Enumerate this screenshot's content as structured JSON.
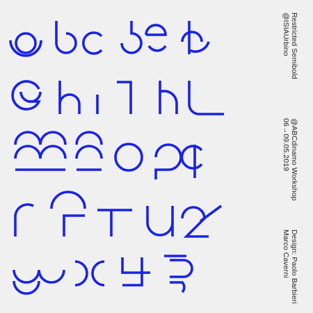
{
  "poster": {
    "accent_color": "#1a22e6",
    "background_color": "#f0f0f0",
    "glyph_rows": [
      [
        "a",
        "b",
        "c",
        "d",
        "e",
        "f"
      ],
      [
        "g",
        "h",
        "i",
        "j",
        "k",
        "l"
      ],
      [
        "m",
        "n",
        "o",
        "p",
        "q"
      ],
      [
        "r",
        "s",
        "t",
        "u",
        "v"
      ],
      [
        "w",
        "x",
        "y",
        "z"
      ]
    ],
    "credits": {
      "typeface": [
        "Restricted Semibold",
        "@ISIAUrbino"
      ],
      "workshop": [
        "@ABCdinamo Workshop",
        "06→09.05.2019"
      ],
      "design": [
        "Design: Paolo Barbieri",
        "Marco Caverni"
      ]
    }
  }
}
